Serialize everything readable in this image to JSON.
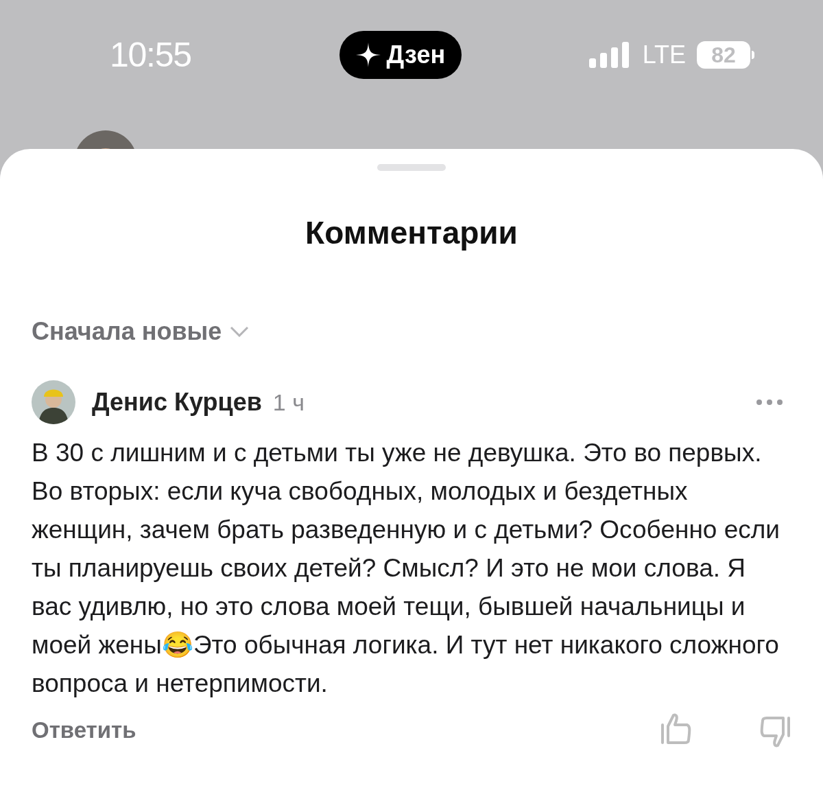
{
  "status_bar": {
    "time": "10:55",
    "app_pill": "Дзен",
    "network": "LTE",
    "battery": "82"
  },
  "sheet": {
    "title": "Комментарии",
    "sort": "Сначала новые",
    "comments": [
      {
        "author": "Денис Курцев",
        "time": "1 ч",
        "text": "В 30 с лишним и с детьми ты уже не девушка. Это во первых. Во вторых: если куча свободных, молодых и бездетных женщин, зачем брать разведенную и с детьми? Особенно если ты планируешь своих детей? Смысл? И это не мои слова. Я вас удивлю, но это слова моей тещи, бывшей начальницы и моей жены😂Это обычная логика. И тут нет никакого сложного вопроса и нетерпимости.",
        "reply": "Ответить"
      }
    ]
  }
}
